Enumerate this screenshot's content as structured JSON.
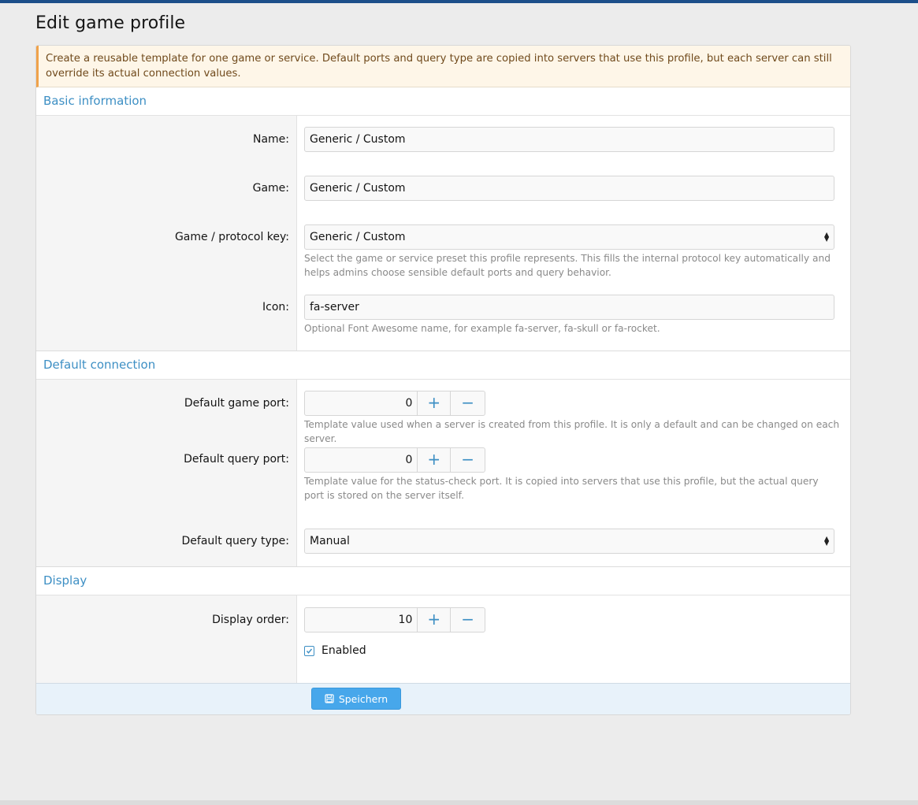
{
  "page": {
    "title": "Edit game profile"
  },
  "notice": {
    "text": "Create a reusable template for one game or service. Default ports and query type are copied into servers that use this profile, but each server can still override its actual connection values."
  },
  "sections": {
    "basic": {
      "title": "Basic information"
    },
    "connection": {
      "title": "Default connection"
    },
    "display": {
      "title": "Display"
    }
  },
  "fields": {
    "name": {
      "label": "Name:",
      "value": "Generic / Custom"
    },
    "game": {
      "label": "Game:",
      "value": "Generic / Custom"
    },
    "protocol": {
      "label": "Game / protocol key:",
      "value": "Generic / Custom",
      "hint": "Select the game or service preset this profile represents. This fills the internal protocol key automatically and helps admins choose sensible default ports and query behavior."
    },
    "icon": {
      "label": "Icon:",
      "value": "fa-server",
      "hint": "Optional Font Awesome name, for example fa-server, fa-skull or fa-rocket."
    },
    "game_port": {
      "label": "Default game port:",
      "value": "0",
      "hint": "Template value used when a server is created from this profile. It is only a default and can be changed on each server."
    },
    "query_port": {
      "label": "Default query port:",
      "value": "0",
      "hint": "Template value for the status-check port. It is copied into servers that use this profile, but the actual query port is stored on the server itself."
    },
    "query_type": {
      "label": "Default query type:",
      "value": "Manual"
    },
    "display_order": {
      "label": "Display order:",
      "value": "10"
    },
    "enabled": {
      "label": "Enabled",
      "checked": true
    }
  },
  "stepper": {
    "plus": "+",
    "minus": "−"
  },
  "actions": {
    "save_label": "Speichern",
    "save_icon": "floppy-disk-icon"
  },
  "colors": {
    "accent": "#3d8fc4",
    "button": "#47a7eb",
    "notice_border": "#f0a24a",
    "topbar": "#1c4f8a"
  }
}
